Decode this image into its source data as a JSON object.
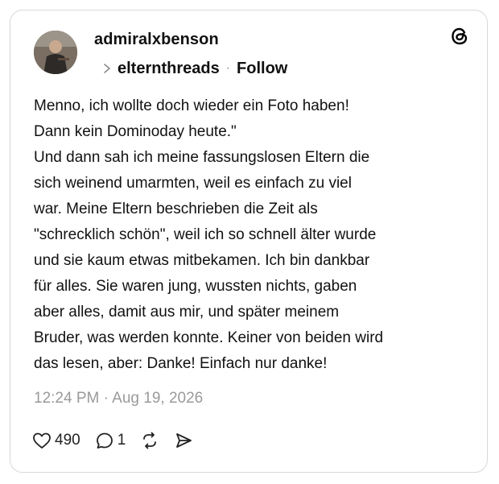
{
  "post": {
    "username": "admiralxbenson",
    "community": "elternthreads",
    "follow_label": "Follow",
    "separator": "·",
    "text_lines": [
      "Menno, ich wollte doch wieder ein Foto haben!",
      "Dann kein Dominoday heute.\"",
      "Und dann sah ich meine fassungslosen Eltern die",
      "sich weinend umarmten, weil es einfach zu viel",
      "war. Meine Eltern beschrieben die Zeit als",
      "\"schrecklich schön\", weil ich so schnell älter wurde",
      "und sie kaum etwas mitbekamen. Ich bin dankbar",
      "für alles. Sie waren jung, wussten nichts, gaben",
      "aber alles, damit aus mir, und später meinem",
      "Bruder, was werden konnte. Keiner von beiden wird",
      "das lesen, aber: Danke! Einfach nur danke!"
    ],
    "timestamp": "12:24 PM · Aug 19, 2026",
    "likes": "490",
    "replies": "1"
  },
  "icons": {
    "app_logo": "threads-logo-icon",
    "like": "heart-icon",
    "reply": "speech-bubble-icon",
    "repost": "repost-icon",
    "share": "send-icon",
    "breadcrumb": "chevron-right-icon"
  },
  "colors": {
    "text": "#111111",
    "muted": "#9a9a9a",
    "border": "#d9d9d9"
  }
}
